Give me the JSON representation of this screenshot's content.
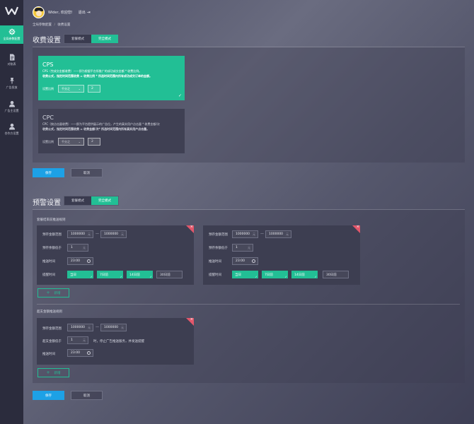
{
  "sidebar": {
    "items": [
      {
        "label": "全局参数配置",
        "icon": "gear-icon",
        "active": true
      },
      {
        "label": "对账表",
        "icon": "document-icon",
        "active": false
      },
      {
        "label": "广告投放",
        "icon": "pin-icon",
        "active": false
      },
      {
        "label": "广告主设置",
        "icon": "user-icon",
        "active": false
      },
      {
        "label": "合作方设置",
        "icon": "user-icon",
        "active": false
      }
    ]
  },
  "header": {
    "user": "Wider, 欢迎您!",
    "logout": "退出"
  },
  "breadcrumb": {
    "root": "全局参数配置",
    "sep": "/",
    "current": "收费设置"
  },
  "fee": {
    "title": "收费设置",
    "modes": [
      "套餐模式",
      "完全模式"
    ],
    "cps": {
      "title": "CPS",
      "desc": "CPS（完成交金额收费）——即为根据平台所推广的成功成交金额 * 收费比例。",
      "formula": "收费公式，指定时间范围收费 = 收费比例 * 所选时间范围内所有成功成交订单的金额。",
      "ratio_label": "设置比例",
      "unit": "千分之",
      "value": "2"
    },
    "cpc": {
      "title": "CPC",
      "desc": "CPC（按点击量收费）——即为平台提供展示的广告位，产生的真实用户点击量 * 收费金额/次",
      "formula": "收费公式，指定时间范围收费 = 收费金额/次* 所选时间范围内所有真实用户点击量。",
      "ratio_label": "设置比例",
      "unit": "千分之",
      "value": "2"
    },
    "save": "保存",
    "cancel": "取消"
  },
  "warn": {
    "title": "预警设置",
    "modes": [
      "套餐模式",
      "完全模式"
    ],
    "package_label": "套餐结束前推送规则",
    "balance_label": "超支金额推送规则",
    "labels": {
      "range": "预存金额范围",
      "below": "预存余额低于",
      "time": "推送时间",
      "remind": "提醒时间",
      "overdraft": "超支金额低于",
      "overdraft_note": "时，停止广告推送服务，并发送提醒"
    },
    "rule_a": {
      "min": "1000000",
      "max": "1000000",
      "unit": "元",
      "below": "1",
      "below_unit": "元",
      "time": "23:00",
      "chips": [
        "当日",
        "7日前",
        "14日前",
        "30日前"
      ]
    },
    "rule_b": {
      "min": "1000000",
      "max": "1000000",
      "unit": "元",
      "below": "1",
      "below_unit": "元",
      "time": "23:00",
      "chips": [
        "当日",
        "7日前",
        "14日前",
        "30日前"
      ]
    },
    "rule_c": {
      "min": "1000000",
      "max": "1000000",
      "unit": "元",
      "below": "1",
      "below_unit": "元",
      "time": "23:00"
    },
    "add": "新增",
    "save": "保存",
    "cancel": "取消"
  },
  "colors": {
    "accent": "#22bf95",
    "primary": "#1da1e6",
    "danger": "#e3576b",
    "sidebar": "#2b2c3d"
  }
}
